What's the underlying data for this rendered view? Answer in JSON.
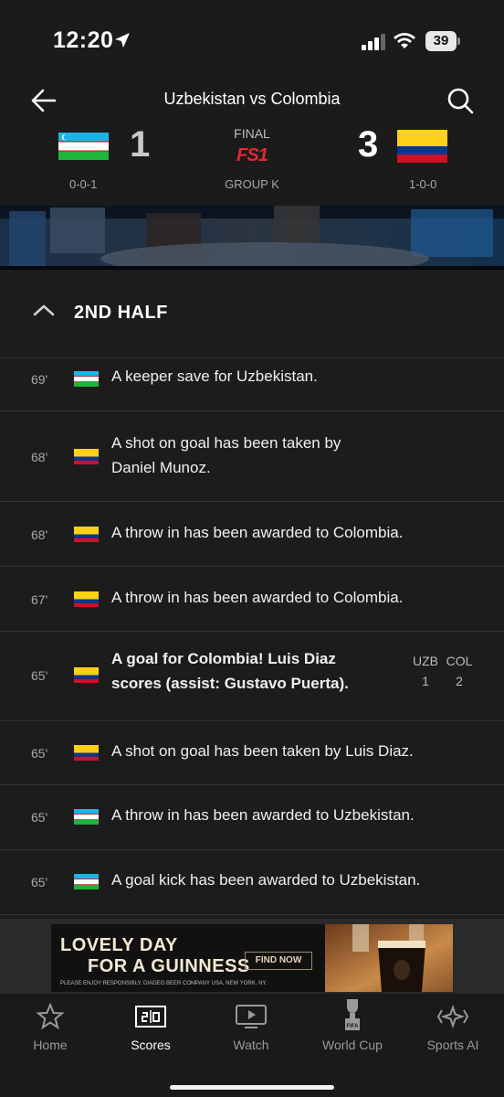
{
  "status_bar": {
    "time": "12:20",
    "battery": "39"
  },
  "header": {
    "title": "Uzbekistan vs Colombia",
    "home": {
      "score": "1",
      "record": "0-0-1"
    },
    "away": {
      "score": "3",
      "record": "1-0-0"
    },
    "status": "FINAL",
    "network": "FS1",
    "group": "GROUP K"
  },
  "feed": {
    "section": "2ND HALF",
    "events": [
      {
        "minute": "69'",
        "team": "uzb",
        "text": "A keeper save for Uzbekistan."
      },
      {
        "minute": "68'",
        "team": "col",
        "text_line1": "A shot on goal has been taken by",
        "text_line2": "Daniel Munoz."
      },
      {
        "minute": "68'",
        "team": "col",
        "text": "A throw in has been awarded to Colombia."
      },
      {
        "minute": "67'",
        "team": "col",
        "text": "A throw in has been awarded to Colombia."
      },
      {
        "minute": "65'",
        "team": "col",
        "text_line1": "A goal for Colombia! Luis Diaz",
        "text_line2": "scores (assist: Gustavo Puerta).",
        "score": {
          "home_abbr": "UZB",
          "away_abbr": "COL",
          "home": "1",
          "away": "2"
        }
      },
      {
        "minute": "65'",
        "team": "col",
        "text": "A shot on goal has been taken by Luis Diaz."
      },
      {
        "minute": "65'",
        "team": "uzb",
        "text": "A throw in has been awarded to Uzbekistan."
      },
      {
        "minute": "65'",
        "team": "uzb",
        "text": "A goal kick has been awarded to Uzbekistan."
      }
    ]
  },
  "ad": {
    "line1": "LOVELY DAY",
    "line2": "FOR A GUINNESS",
    "button": "FIND NOW",
    "fine_print": "PLEASE ENJOY RESPONSIBLY.   DIAGEO BEER COMPANY USA, NEW YORK, NY."
  },
  "tabs": [
    {
      "label": "Home",
      "icon": "star-icon"
    },
    {
      "label": "Scores",
      "icon": "scoreboard-icon"
    },
    {
      "label": "Watch",
      "icon": "tv-play-icon"
    },
    {
      "label": "World Cup",
      "icon": "trophy-icon"
    },
    {
      "label": "Sports AI",
      "icon": "sparkle-icon"
    }
  ],
  "colors": {
    "background": "#1c1c1c",
    "fs1_red": "#e8282f",
    "colombia_yellow": "#fcd116",
    "colombia_blue": "#003893",
    "colombia_red": "#ce1126",
    "uzbekistan_blue": "#1eb3e6",
    "uzbekistan_green": "#1eb53a"
  }
}
